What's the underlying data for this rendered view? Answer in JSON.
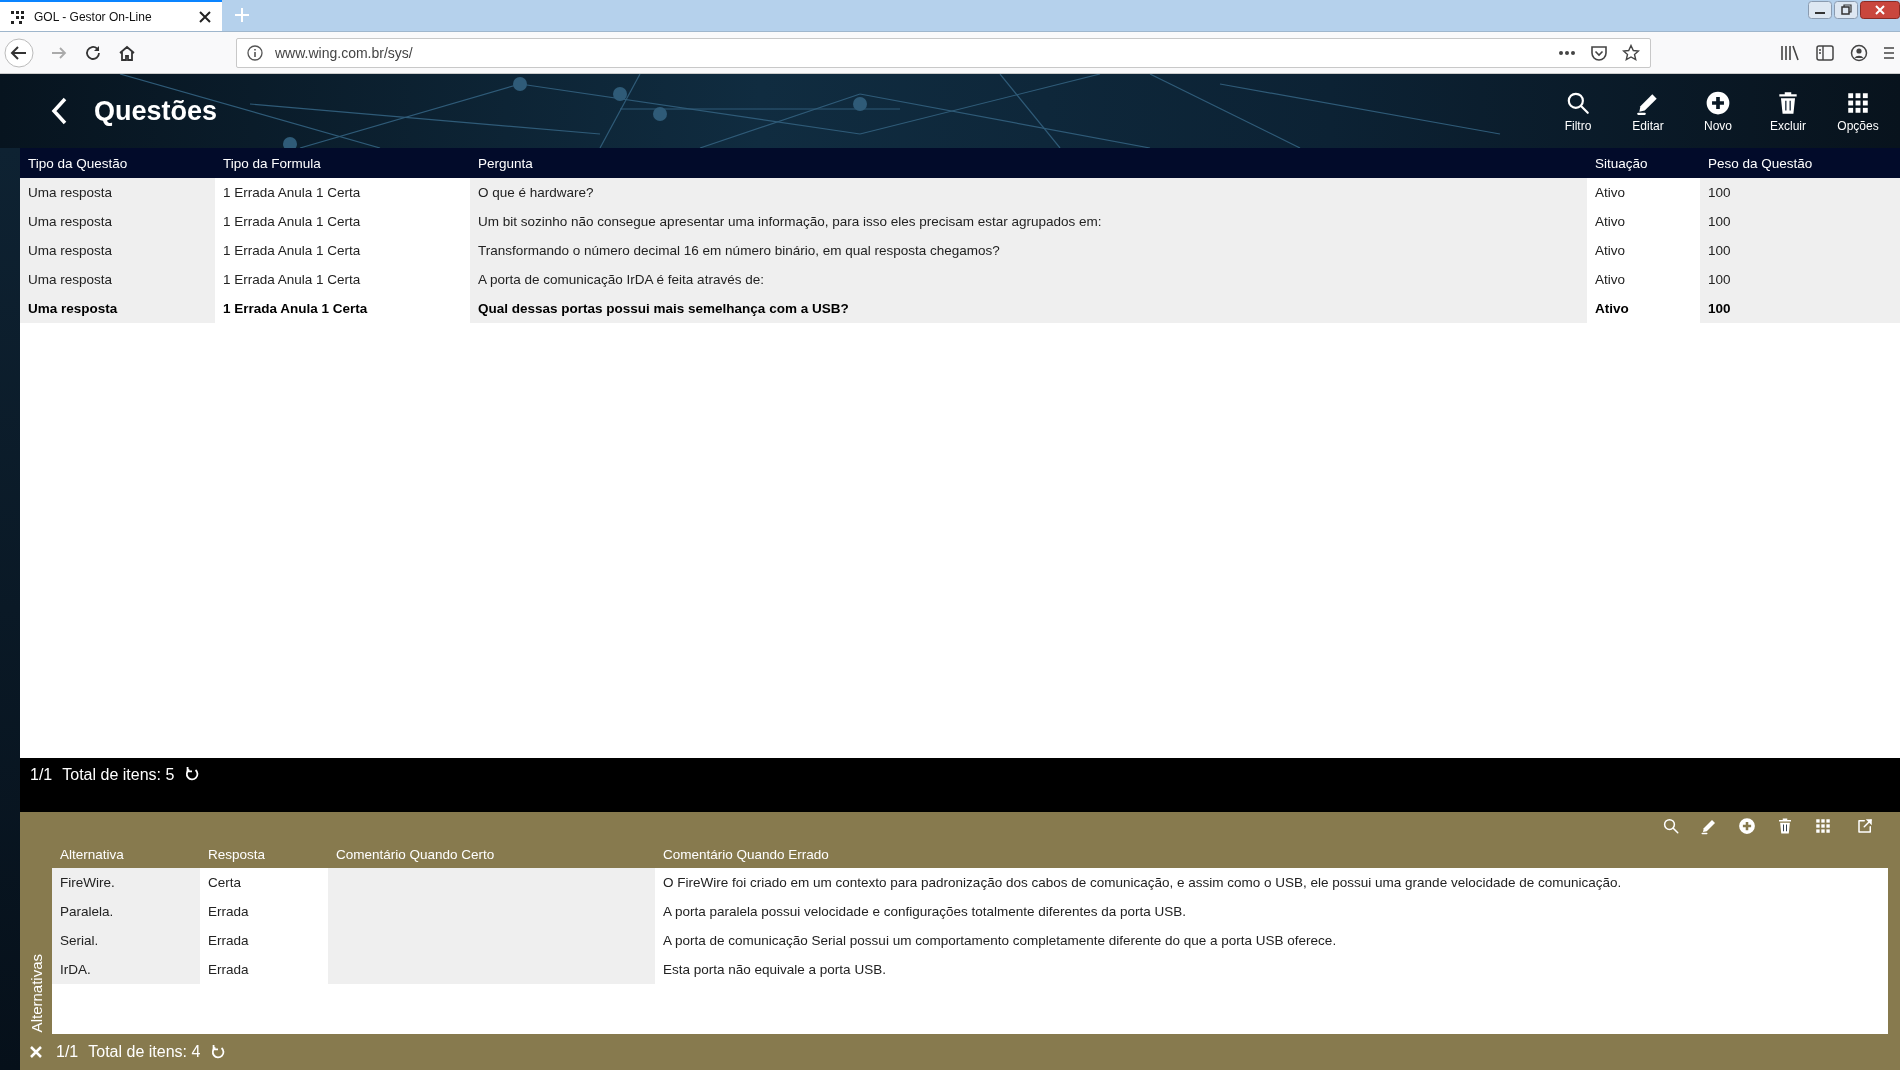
{
  "browser": {
    "tab_title": "GOL - Gestor On-Line",
    "url": "www.wing.com.br/sys/"
  },
  "header": {
    "title": "Questões",
    "actions": [
      {
        "label": "Filtro"
      },
      {
        "label": "Editar"
      },
      {
        "label": "Novo"
      },
      {
        "label": "Excluir"
      },
      {
        "label": "Opções"
      }
    ]
  },
  "table": {
    "columns": [
      "Tipo da Questão",
      "Tipo da Formula",
      "Pergunta",
      "Situação",
      "Peso da Questão"
    ],
    "rows": [
      {
        "cells": [
          "Uma resposta",
          "1 Errada Anula 1 Certa",
          "O que é hardware?",
          "Ativo",
          "100"
        ],
        "selected": false
      },
      {
        "cells": [
          "Uma resposta",
          "1 Errada Anula 1 Certa",
          "Um bit sozinho não consegue apresentar uma informação, para isso eles precisam estar agrupados em:",
          "Ativo",
          "100"
        ],
        "selected": false
      },
      {
        "cells": [
          "Uma resposta",
          "1 Errada Anula 1 Certa",
          "Transformando o número decimal 16 em número binário, em qual resposta chegamos?",
          "Ativo",
          "100"
        ],
        "selected": false
      },
      {
        "cells": [
          "Uma resposta",
          "1 Errada Anula 1 Certa",
          "A porta de comunicação IrDA é feita através de:",
          "Ativo",
          "100"
        ],
        "selected": false
      },
      {
        "cells": [
          "Uma resposta",
          "1 Errada Anula 1 Certa",
          "Qual dessas portas possui mais semelhança com a USB?",
          "Ativo",
          "100"
        ],
        "selected": true
      }
    ]
  },
  "pager": {
    "page": "1/1",
    "total": "Total de itens: 5"
  },
  "detail": {
    "title": "Alternativas",
    "columns": [
      "Alternativa",
      "Resposta",
      "Comentário Quando Certo",
      "Comentário Quando Errado"
    ],
    "rows": [
      {
        "alternativa": "FireWire.",
        "resposta": "Certa",
        "comentario_errado": "O FireWire foi criado em um contexto para padronização dos cabos de comunicação, e assim como o USB, ele possui uma grande velocidade de comunicação."
      },
      {
        "alternativa": "Paralela.",
        "resposta": "Errada",
        "comentario_errado": "A porta paralela possui velocidade e configurações totalmente diferentes da porta USB."
      },
      {
        "alternativa": "Serial.",
        "resposta": "Errada",
        "comentario_errado": "A porta de comunicação Serial possui um comportamento completamente diferente do que a porta USB oferece."
      },
      {
        "alternativa": "IrDA.",
        "resposta": "Errada",
        "comentario_errado": "Esta porta não equivale a porta USB."
      }
    ],
    "pager": {
      "page": "1/1",
      "total": "Total de itens: 4"
    }
  }
}
